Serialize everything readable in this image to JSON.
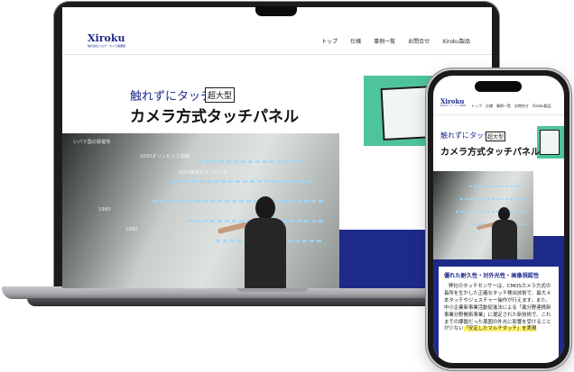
{
  "site": {
    "logo": "Xiroku",
    "logo_sub": "株式会社シロク・カメラ事業部",
    "nav": [
      "トップ",
      "仕様",
      "事例一覧",
      "お問合せ",
      "Xiroku製品"
    ],
    "hero": {
      "kicker": "触れずにタッチ",
      "badge": "超大型",
      "title": "カメラ方式タッチパネル"
    },
    "photo_labels": [
      "いパラ国の開催地",
      "2020オリンピック開催",
      "1960",
      "2021東京オリンピック",
      "1980"
    ],
    "section": {
      "heading": "優れた耐久性・対外光性・画像視認性",
      "body_before": "弊社のタッチセンサーは、CMOSカメラ方式の長所を生かした正確なタッチ検出技術で、最大４本タッチやジェスチャー操作が行えます。また、中小企業新事業活動促進法による「異分野連携新事業分野開拓事業」に選定された新技術で、これまでの課題だった周囲の外光に影響を受けることが少ない",
      "body_highlight": "「安定したマルチタッチ」を実現"
    }
  },
  "colors": {
    "brand_navy": "#1e2a8a",
    "accent_teal": "#4ec49a",
    "highlight_yellow": "#fff46a"
  },
  "devices": [
    "laptop",
    "smartphone"
  ]
}
